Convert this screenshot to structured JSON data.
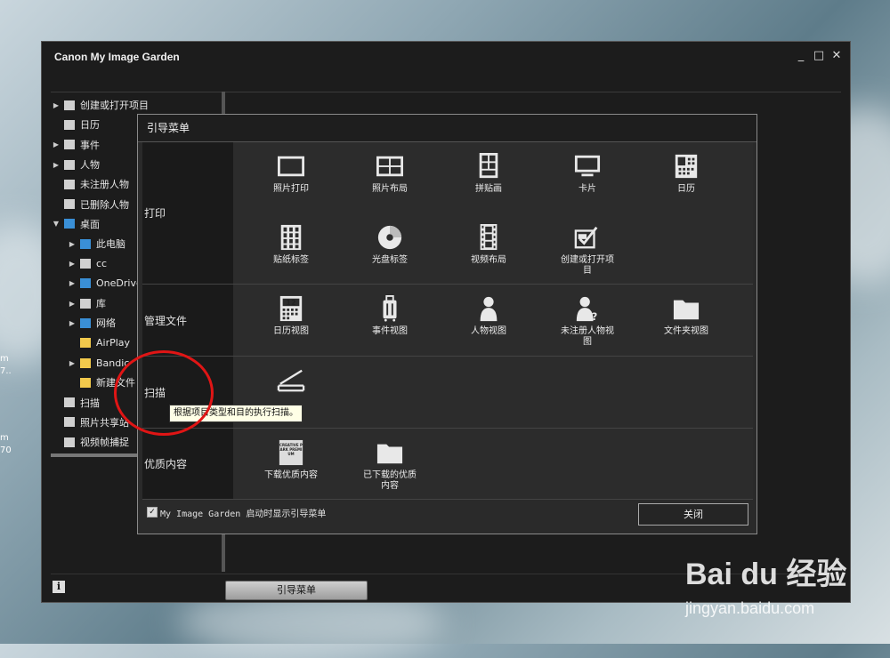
{
  "desktop": {
    "left_labels": [
      "m",
      "7..",
      "m",
      "70"
    ]
  },
  "window": {
    "title": "Canon My Image Garden",
    "controls": [
      "_",
      "□",
      "✕"
    ],
    "tree": [
      {
        "label": "创建或打开项目",
        "expander": "▶",
        "icon": "project-icon",
        "indent": 0
      },
      {
        "label": "日历",
        "expander": "",
        "icon": "calendar-icon",
        "indent": 0
      },
      {
        "label": "事件",
        "expander": "▶",
        "icon": "event-icon",
        "indent": 0
      },
      {
        "label": "人物",
        "expander": "▶",
        "icon": "person-icon",
        "indent": 0
      },
      {
        "label": "未注册人物",
        "expander": "",
        "icon": "unregistered-person-icon",
        "indent": 0
      },
      {
        "label": "已删除人物",
        "expander": "",
        "icon": "deleted-person-icon",
        "indent": 0
      },
      {
        "label": "桌面",
        "expander": "▼",
        "icon": "desktop-folder-icon",
        "indent": 0
      },
      {
        "label": "此电脑",
        "expander": "▶",
        "icon": "computer-icon",
        "indent": 1
      },
      {
        "label": "cc",
        "expander": "▶",
        "icon": "user-icon",
        "indent": 1
      },
      {
        "label": "OneDrive",
        "expander": "▶",
        "icon": "cloud-icon",
        "indent": 1
      },
      {
        "label": "库",
        "expander": "▶",
        "icon": "library-icon",
        "indent": 1
      },
      {
        "label": "网络",
        "expander": "▶",
        "icon": "network-icon",
        "indent": 1
      },
      {
        "label": "AirPlay",
        "expander": "",
        "icon": "folder-icon",
        "indent": 1
      },
      {
        "label": "Bandic",
        "expander": "▶",
        "icon": "folder-icon",
        "indent": 1
      },
      {
        "label": "新建文件",
        "expander": "",
        "icon": "folder-icon",
        "indent": 1
      },
      {
        "label": "扫描",
        "expander": "",
        "icon": "scan-icon",
        "indent": 0
      },
      {
        "label": "照片共享站",
        "expander": "",
        "icon": "photo-share-icon",
        "indent": 0
      },
      {
        "label": "视频帧捕捉",
        "expander": "",
        "icon": "video-frame-icon",
        "indent": 0
      }
    ],
    "info_label": "i",
    "guide_button": "引导菜单"
  },
  "dialog": {
    "title": "引导菜单",
    "sections": [
      {
        "label": "打印",
        "items": [
          {
            "label": "照片打印",
            "icon": "photo-print-icon"
          },
          {
            "label": "照片布局",
            "icon": "photo-layout-icon"
          },
          {
            "label": "拼贴画",
            "icon": "collage-icon"
          },
          {
            "label": "卡片",
            "icon": "card-icon"
          },
          {
            "label": "日历",
            "icon": "calendar-icon"
          },
          {
            "label": "贴纸标签",
            "icon": "sticker-label-icon"
          },
          {
            "label": "光盘标签",
            "icon": "disc-label-icon"
          },
          {
            "label": "视频布局",
            "icon": "video-layout-icon"
          },
          {
            "label": "创建或打开项目",
            "icon": "create-project-icon"
          }
        ]
      },
      {
        "label": "管理文件",
        "items": [
          {
            "label": "日历视图",
            "icon": "calendar-view-icon",
            "badge": "12"
          },
          {
            "label": "事件视图",
            "icon": "event-view-icon"
          },
          {
            "label": "人物视图",
            "icon": "person-view-icon"
          },
          {
            "label": "未注册人物视图",
            "icon": "unregistered-person-view-icon"
          },
          {
            "label": "文件夹视图",
            "icon": "folder-view-icon"
          }
        ]
      },
      {
        "label": "扫描",
        "items": [
          {
            "label": "",
            "icon": "scan-icon"
          }
        ]
      },
      {
        "label": "优质内容",
        "items": [
          {
            "label": "下载优质内容",
            "icon": "premium-content-icon",
            "badge": "CREATIVE PARK PREMIUM"
          },
          {
            "label": "已下载的优质内容",
            "icon": "downloaded-content-icon"
          }
        ]
      }
    ],
    "tooltip": "根据项目类型和目的执行扫描。",
    "checkbox": {
      "checked": true,
      "mark": "✓",
      "label": "My Image Garden 启动时显示引导菜单"
    },
    "close_button": "关闭"
  },
  "watermark": {
    "brand": "Bai du 经验",
    "url": "jingyan.baidu.com"
  },
  "colors": {
    "window_bg": "#1c1c1c",
    "dialog_bg": "#2a2a2a",
    "annotation_circle": "#e01515",
    "tooltip_bg": "#ffffe6"
  }
}
